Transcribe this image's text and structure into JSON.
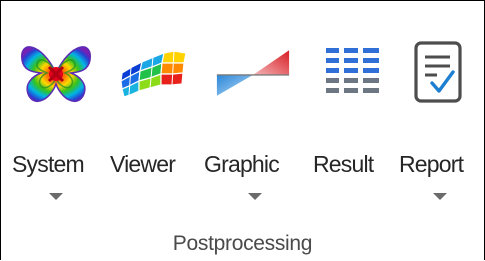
{
  "ribbon": {
    "group_label": "Postprocessing",
    "buttons": [
      {
        "label": "System",
        "icon": "system-mode-shape-icon",
        "has_dropdown": true
      },
      {
        "label": "Viewer",
        "icon": "viewer-surface-plot-icon",
        "has_dropdown": false
      },
      {
        "label": "Graphic",
        "icon": "graphic-wedge-icon",
        "has_dropdown": true
      },
      {
        "label": "Result",
        "icon": "result-table-icon",
        "has_dropdown": false
      },
      {
        "label": "Report",
        "icon": "report-checklist-icon",
        "has_dropdown": true
      }
    ]
  },
  "colors": {
    "text": "#262626",
    "dropdown_arrow": "#6b6b6b",
    "result_blue": "#2f6fd6",
    "graphic_red": "#d71d24",
    "graphic_blue": "#2a86d9"
  }
}
